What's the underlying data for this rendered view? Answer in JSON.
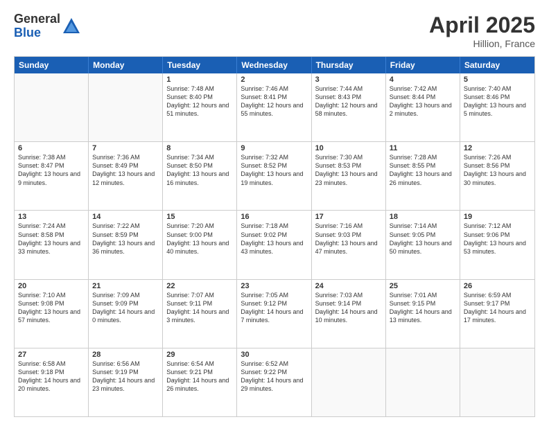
{
  "logo": {
    "general": "General",
    "blue": "Blue"
  },
  "title": {
    "month": "April 2025",
    "location": "Hillion, France"
  },
  "header_days": [
    "Sunday",
    "Monday",
    "Tuesday",
    "Wednesday",
    "Thursday",
    "Friday",
    "Saturday"
  ],
  "weeks": [
    [
      {
        "day": "",
        "info": ""
      },
      {
        "day": "",
        "info": ""
      },
      {
        "day": "1",
        "info": "Sunrise: 7:48 AM\nSunset: 8:40 PM\nDaylight: 12 hours and 51 minutes."
      },
      {
        "day": "2",
        "info": "Sunrise: 7:46 AM\nSunset: 8:41 PM\nDaylight: 12 hours and 55 minutes."
      },
      {
        "day": "3",
        "info": "Sunrise: 7:44 AM\nSunset: 8:43 PM\nDaylight: 12 hours and 58 minutes."
      },
      {
        "day": "4",
        "info": "Sunrise: 7:42 AM\nSunset: 8:44 PM\nDaylight: 13 hours and 2 minutes."
      },
      {
        "day": "5",
        "info": "Sunrise: 7:40 AM\nSunset: 8:46 PM\nDaylight: 13 hours and 5 minutes."
      }
    ],
    [
      {
        "day": "6",
        "info": "Sunrise: 7:38 AM\nSunset: 8:47 PM\nDaylight: 13 hours and 9 minutes."
      },
      {
        "day": "7",
        "info": "Sunrise: 7:36 AM\nSunset: 8:49 PM\nDaylight: 13 hours and 12 minutes."
      },
      {
        "day": "8",
        "info": "Sunrise: 7:34 AM\nSunset: 8:50 PM\nDaylight: 13 hours and 16 minutes."
      },
      {
        "day": "9",
        "info": "Sunrise: 7:32 AM\nSunset: 8:52 PM\nDaylight: 13 hours and 19 minutes."
      },
      {
        "day": "10",
        "info": "Sunrise: 7:30 AM\nSunset: 8:53 PM\nDaylight: 13 hours and 23 minutes."
      },
      {
        "day": "11",
        "info": "Sunrise: 7:28 AM\nSunset: 8:55 PM\nDaylight: 13 hours and 26 minutes."
      },
      {
        "day": "12",
        "info": "Sunrise: 7:26 AM\nSunset: 8:56 PM\nDaylight: 13 hours and 30 minutes."
      }
    ],
    [
      {
        "day": "13",
        "info": "Sunrise: 7:24 AM\nSunset: 8:58 PM\nDaylight: 13 hours and 33 minutes."
      },
      {
        "day": "14",
        "info": "Sunrise: 7:22 AM\nSunset: 8:59 PM\nDaylight: 13 hours and 36 minutes."
      },
      {
        "day": "15",
        "info": "Sunrise: 7:20 AM\nSunset: 9:00 PM\nDaylight: 13 hours and 40 minutes."
      },
      {
        "day": "16",
        "info": "Sunrise: 7:18 AM\nSunset: 9:02 PM\nDaylight: 13 hours and 43 minutes."
      },
      {
        "day": "17",
        "info": "Sunrise: 7:16 AM\nSunset: 9:03 PM\nDaylight: 13 hours and 47 minutes."
      },
      {
        "day": "18",
        "info": "Sunrise: 7:14 AM\nSunset: 9:05 PM\nDaylight: 13 hours and 50 minutes."
      },
      {
        "day": "19",
        "info": "Sunrise: 7:12 AM\nSunset: 9:06 PM\nDaylight: 13 hours and 53 minutes."
      }
    ],
    [
      {
        "day": "20",
        "info": "Sunrise: 7:10 AM\nSunset: 9:08 PM\nDaylight: 13 hours and 57 minutes."
      },
      {
        "day": "21",
        "info": "Sunrise: 7:09 AM\nSunset: 9:09 PM\nDaylight: 14 hours and 0 minutes."
      },
      {
        "day": "22",
        "info": "Sunrise: 7:07 AM\nSunset: 9:11 PM\nDaylight: 14 hours and 3 minutes."
      },
      {
        "day": "23",
        "info": "Sunrise: 7:05 AM\nSunset: 9:12 PM\nDaylight: 14 hours and 7 minutes."
      },
      {
        "day": "24",
        "info": "Sunrise: 7:03 AM\nSunset: 9:14 PM\nDaylight: 14 hours and 10 minutes."
      },
      {
        "day": "25",
        "info": "Sunrise: 7:01 AM\nSunset: 9:15 PM\nDaylight: 14 hours and 13 minutes."
      },
      {
        "day": "26",
        "info": "Sunrise: 6:59 AM\nSunset: 9:17 PM\nDaylight: 14 hours and 17 minutes."
      }
    ],
    [
      {
        "day": "27",
        "info": "Sunrise: 6:58 AM\nSunset: 9:18 PM\nDaylight: 14 hours and 20 minutes."
      },
      {
        "day": "28",
        "info": "Sunrise: 6:56 AM\nSunset: 9:19 PM\nDaylight: 14 hours and 23 minutes."
      },
      {
        "day": "29",
        "info": "Sunrise: 6:54 AM\nSunset: 9:21 PM\nDaylight: 14 hours and 26 minutes."
      },
      {
        "day": "30",
        "info": "Sunrise: 6:52 AM\nSunset: 9:22 PM\nDaylight: 14 hours and 29 minutes."
      },
      {
        "day": "",
        "info": ""
      },
      {
        "day": "",
        "info": ""
      },
      {
        "day": "",
        "info": ""
      }
    ]
  ]
}
